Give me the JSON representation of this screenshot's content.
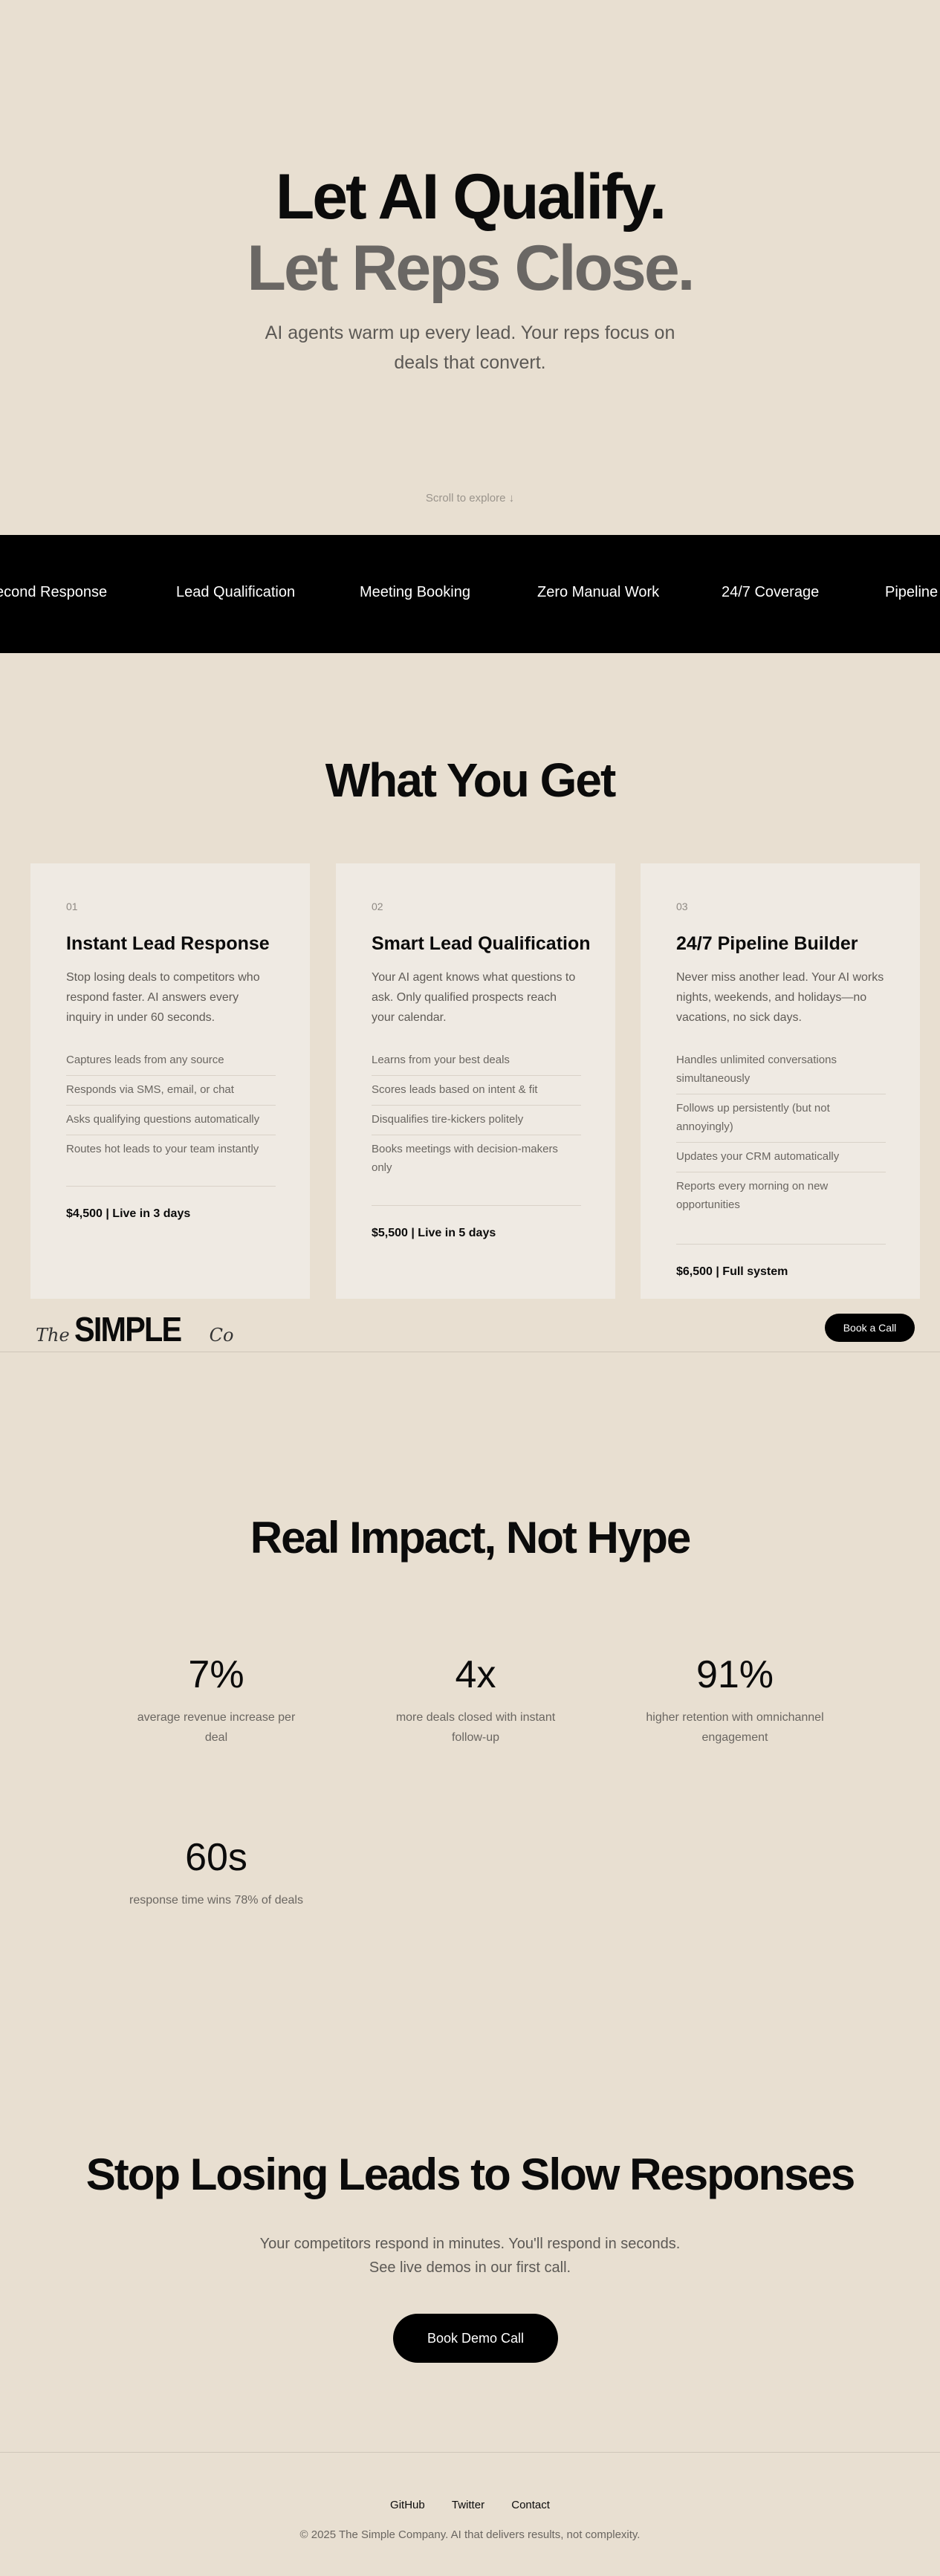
{
  "hero": {
    "line1": "Let AI Qualify.",
    "line2": "Let Reps Close.",
    "subtitle": "AI agents warm up every lead. Your reps focus on deals that convert.",
    "scroll_hint": "Scroll to explore ↓"
  },
  "marquee": {
    "items": [
      "econd Response",
      "Lead Qualification",
      "Meeting Booking",
      "Zero Manual Work",
      "24/7 Coverage",
      "Pipeline C"
    ]
  },
  "what_you_get": {
    "title": "What You Get",
    "cards": [
      {
        "num": "01",
        "title": "Instant Lead Response",
        "desc": "Stop losing deals to competitors who respond faster. AI answers every inquiry in under 60 seconds.",
        "features": [
          "Captures leads from any source",
          "Responds via SMS, email, or chat",
          "Asks qualifying questions automatically",
          "Routes hot leads to your team instantly"
        ],
        "price": "$4,500 | Live in 3 days"
      },
      {
        "num": "02",
        "title": "Smart Lead Qualification",
        "desc": "Your AI agent knows what questions to ask. Only qualified prospects reach your calendar.",
        "features": [
          "Learns from your best deals",
          "Scores leads based on intent & fit",
          "Disqualifies tire-kickers politely",
          "Books meetings with decision-makers only"
        ],
        "price": "$5,500 | Live in 5 days"
      },
      {
        "num": "03",
        "title": "24/7 Pipeline Builder",
        "desc": "Never miss another lead. Your AI works nights, weekends, and holidays—no vacations, no sick days.",
        "features": [
          "Handles unlimited conversations simultaneously",
          "Follows up persistently (but not annoyingly)",
          "Updates your CRM automatically",
          "Reports every morning on new opportunities"
        ],
        "price": "$6,500 | Full system"
      }
    ]
  },
  "nav": {
    "logo_the": "The",
    "logo_simple": "SIMPLE",
    "logo_co": "Co",
    "book_call": "Book a Call"
  },
  "impact": {
    "title": "Real Impact, Not Hype",
    "stats": [
      {
        "value": "7%",
        "label": "average revenue increase per deal"
      },
      {
        "value": "4x",
        "label": "more deals closed with instant follow-up"
      },
      {
        "value": "91%",
        "label": "higher retention with omnichannel engagement"
      },
      {
        "value": "60s",
        "label": "response time wins 78% of deals"
      }
    ]
  },
  "cta": {
    "title": "Stop Losing Leads to Slow Responses",
    "subtitle": "Your competitors respond in minutes. You'll respond in seconds. See live demos in our first call.",
    "button": "Book Demo Call"
  },
  "footer": {
    "links": [
      "GitHub",
      "Twitter",
      "Contact"
    ],
    "copyright": "© 2025 The Simple Company. AI that delivers results, not complexity."
  }
}
